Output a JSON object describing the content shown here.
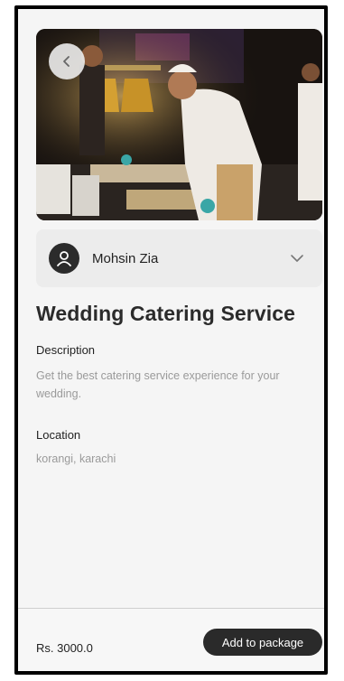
{
  "vendor": {
    "name": "Mohsin Zia"
  },
  "service": {
    "title": "Wedding Catering Service",
    "description_label": "Description",
    "description": "Get the best catering service experience for your wedding.",
    "location_label": "Location",
    "location": "korangi, karachi"
  },
  "footer": {
    "price": "Rs. 3000.0",
    "add_button_label": "Add to package"
  },
  "icons": {
    "back": "chevron-left-icon",
    "avatar": "user-icon",
    "expand": "chevron-down-icon"
  },
  "colors": {
    "primary_dark": "#2a2a2a",
    "background": "#f5f5f5",
    "muted_text": "#9a9a9a"
  }
}
